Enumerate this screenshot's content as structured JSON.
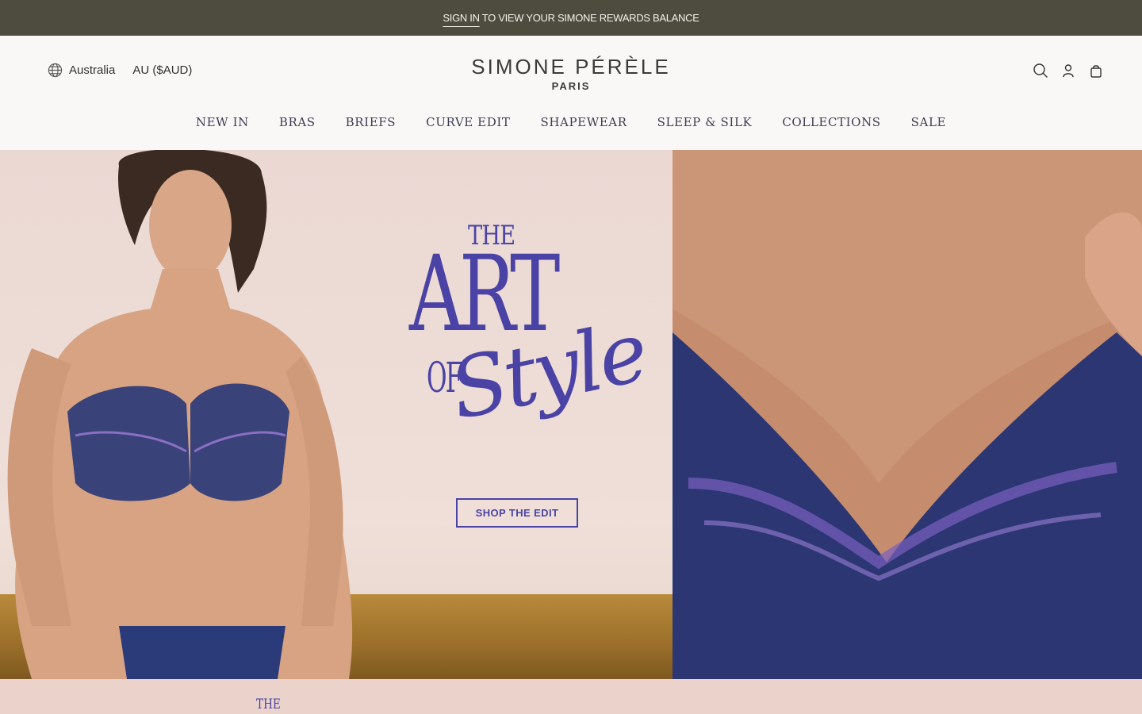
{
  "announcement": {
    "link_text": "SIGN IN",
    "text": "TO VIEW YOUR SIMONE REWARDS BALANCE"
  },
  "locale": {
    "country": "Australia",
    "currency": "AU ($AUD)"
  },
  "logo": {
    "main": "SIMONE PÉRÈLE",
    "sub": "PARIS"
  },
  "utility": {
    "icons": [
      "search-icon",
      "account-icon",
      "bag-icon"
    ]
  },
  "nav": {
    "items": [
      "NEW IN",
      "BRAS",
      "BRIEFS",
      "CURVE EDIT",
      "SHAPEWEAR",
      "SLEEP & SILK",
      "COLLECTIONS",
      "SALE"
    ]
  },
  "hero": {
    "headline_the": "THE",
    "headline_art": "ART",
    "headline_of": "OF",
    "headline_style": "Style",
    "cta": "SHOP THE EDIT",
    "accent_color": "#4a43a5"
  },
  "next_section": {
    "headline_the": "THE"
  },
  "colors": {
    "announcement_bg": "#4e4b3f",
    "header_bg": "#faf8f6",
    "hero_left_bg": "#ebd8d3",
    "next_section_bg": "#ebd3cb"
  }
}
